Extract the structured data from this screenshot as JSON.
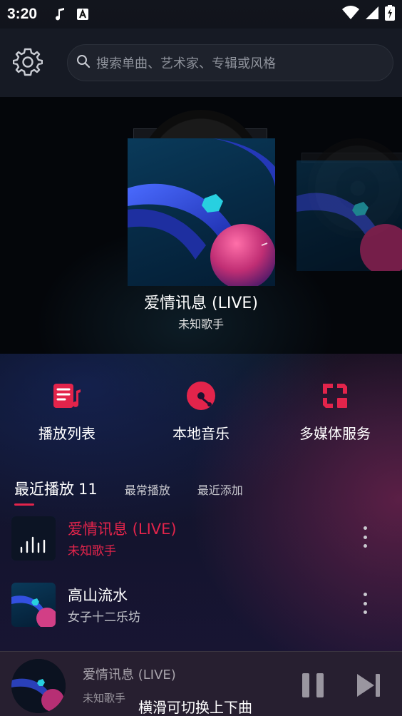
{
  "status": {
    "time": "3:20"
  },
  "search": {
    "placeholder": "搜索单曲、艺术家、专辑或风格"
  },
  "now_playing": {
    "title": "爱情讯息 (LIVE)",
    "artist": "未知歌手"
  },
  "actions": [
    {
      "label": "播放列表",
      "icon": "playlist-icon"
    },
    {
      "label": "本地音乐",
      "icon": "vinyl-disc-icon"
    },
    {
      "label": "多媒体服务",
      "icon": "media-services-icon"
    }
  ],
  "tabs": {
    "active_label": "最近播放",
    "active_count": "11",
    "frequent": "最常播放",
    "added": "最近添加"
  },
  "recent_list": [
    {
      "title": "爱情讯息 (LIVE)",
      "artist": "未知歌手",
      "playing": true
    },
    {
      "title": "高山流水",
      "artist": "女子十二乐坊",
      "playing": false
    }
  ],
  "mini_player": {
    "title": "爱情讯息 (LIVE)",
    "artist": "未知歌手",
    "hint": "横滑可切换上下曲"
  },
  "colors": {
    "accent": "#e3244b",
    "background": "#0b0e17",
    "header": "#161a24"
  }
}
